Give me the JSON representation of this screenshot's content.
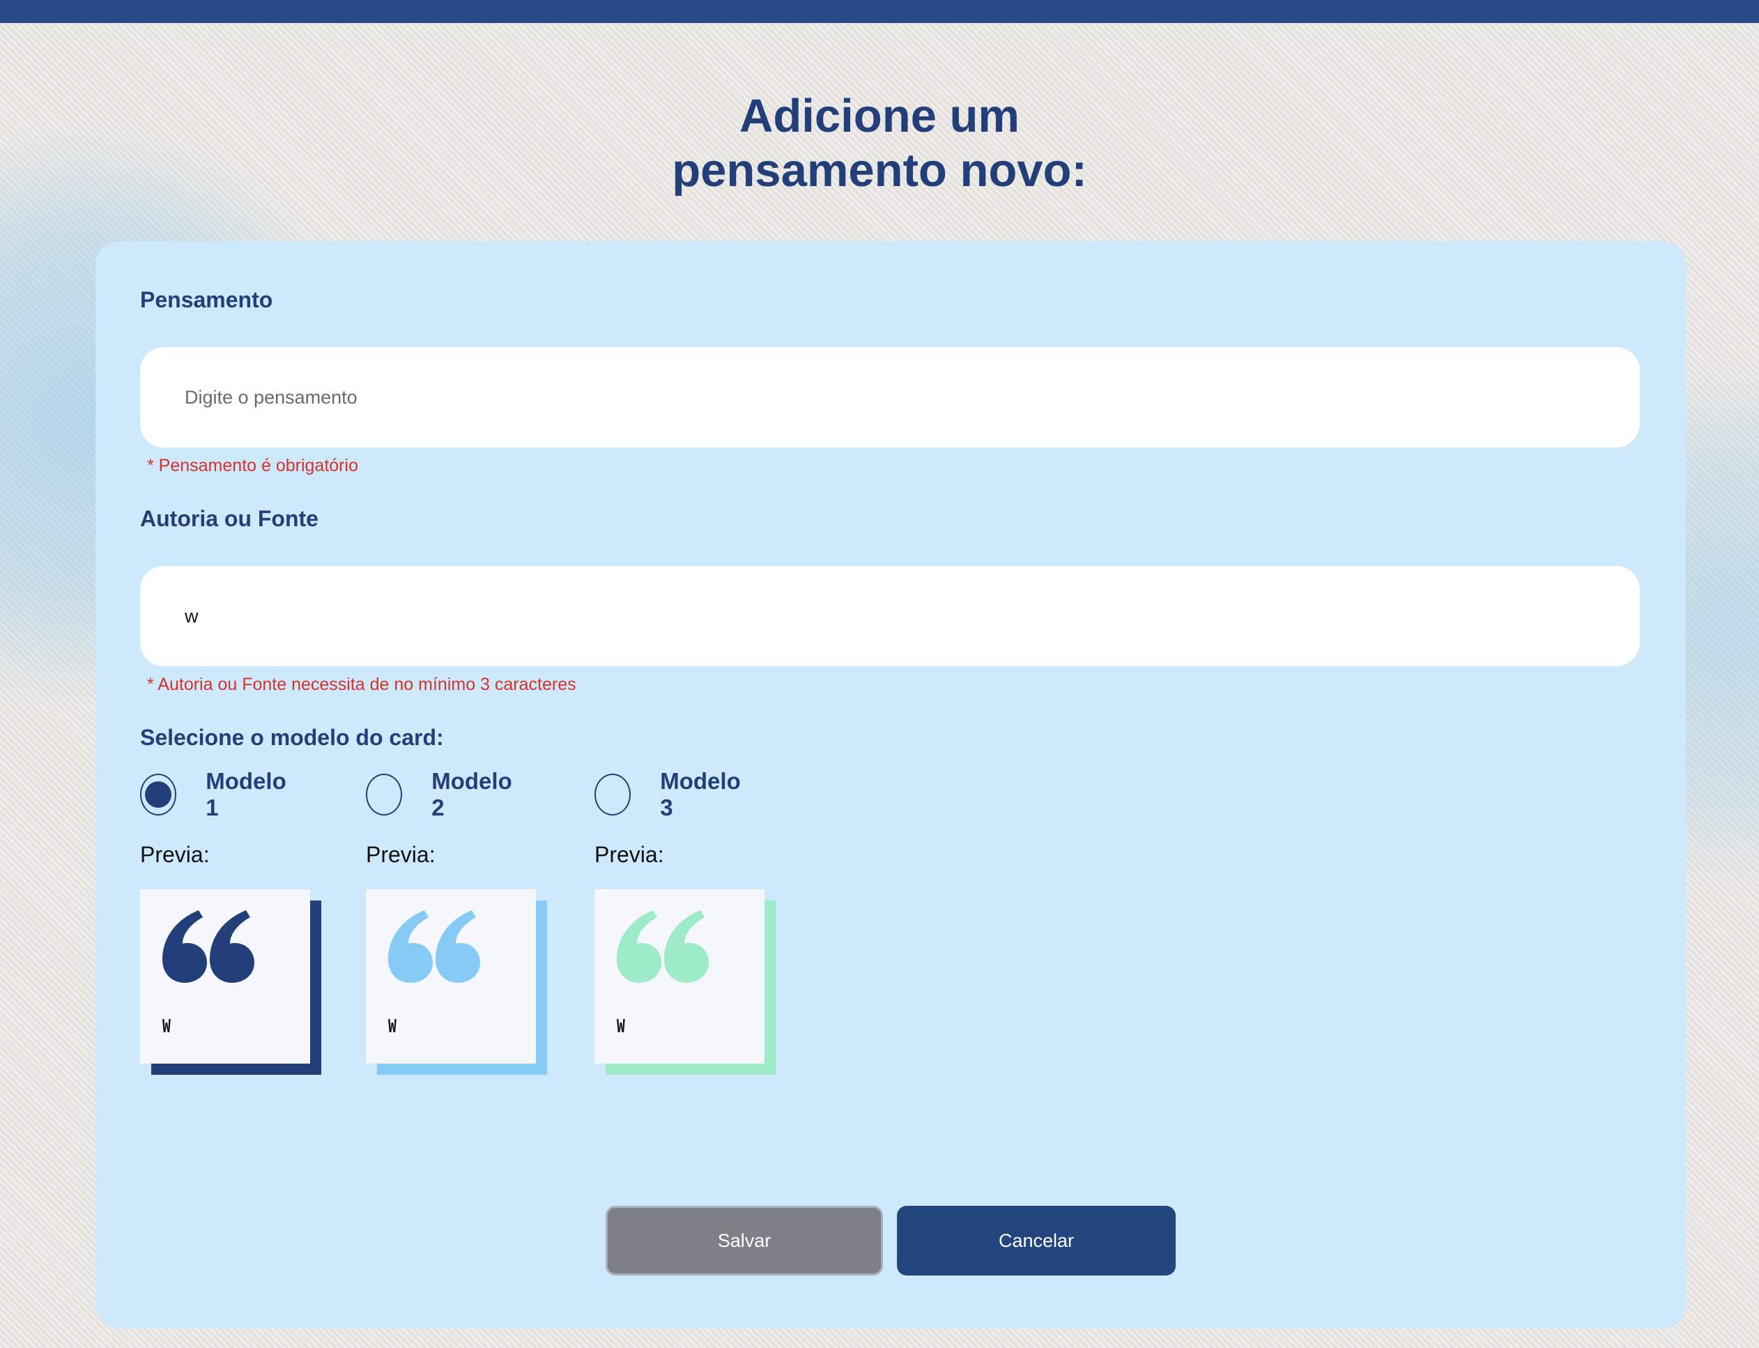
{
  "title": {
    "line1": "Adicione um",
    "line2": "pensamento novo:"
  },
  "form": {
    "thought": {
      "label": "Pensamento",
      "placeholder": "Digite o pensamento",
      "value": "",
      "error": "* Pensamento é obrigatório"
    },
    "author": {
      "label": "Autoria ou Fonte",
      "value": "w",
      "error": "* Autoria ou Fonte necessita de no mínimo 3 caracteres"
    },
    "model": {
      "label": "Selecione o modelo do card:",
      "options": [
        {
          "label": "Modelo 1",
          "selected": true,
          "color": "#223f7a"
        },
        {
          "label": "Modelo 2",
          "selected": false,
          "color": "#86cbf6"
        },
        {
          "label": "Modelo 3",
          "selected": false,
          "color": "#9debc7"
        }
      ],
      "preview_label": "Previa:",
      "preview_author": "W"
    }
  },
  "buttons": {
    "save": "Salvar",
    "cancel": "Cancelar"
  },
  "colors": {
    "primary": "#223f7a",
    "panel": "#cde9fb",
    "error": "#d7322a",
    "topbar": "#27498a"
  },
  "icons": [
    "quote-icon"
  ]
}
